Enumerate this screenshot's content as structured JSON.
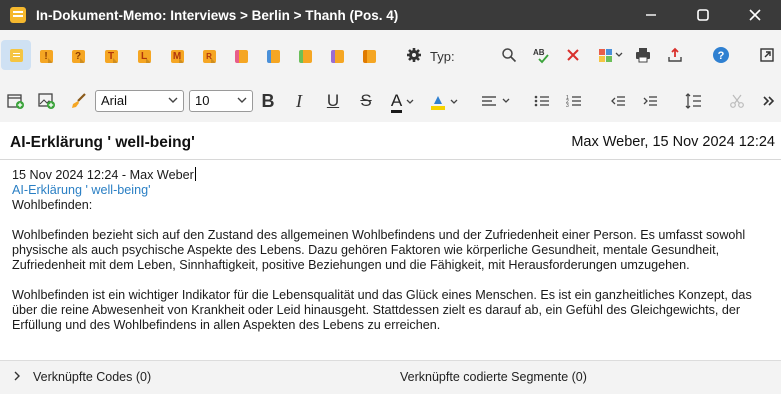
{
  "window": {
    "title": "In-Dokument-Memo: Interviews > Berlin > Thanh (Pos. 4)"
  },
  "toolbar1": {
    "memo_types": [
      {
        "name": "memo-default",
        "letter": "",
        "color": "#f5c542"
      },
      {
        "name": "memo-exclamation",
        "letter": "!",
        "color": "#f5a623"
      },
      {
        "name": "memo-question",
        "letter": "?",
        "color": "#f5a623"
      },
      {
        "name": "memo-t",
        "letter": "T",
        "color": "#f5a623"
      },
      {
        "name": "memo-l",
        "letter": "L",
        "color": "#f5a623"
      },
      {
        "name": "memo-m",
        "letter": "M",
        "color": "#f5a623"
      },
      {
        "name": "memo-r",
        "letter": "R",
        "color": "#f5a623"
      },
      {
        "name": "memo-pink",
        "letter": "",
        "color": "#e85d8a"
      },
      {
        "name": "memo-blue",
        "letter": "",
        "color": "#4a90d9"
      },
      {
        "name": "memo-green",
        "letter": "",
        "color": "#6bbf59"
      },
      {
        "name": "memo-purple",
        "letter": "",
        "color": "#9b6bd1"
      },
      {
        "name": "memo-orange",
        "letter": "",
        "color": "#f5a623"
      }
    ],
    "type_label": "Typ:"
  },
  "toolbar2": {
    "font_family": "Arial",
    "font_size": "10",
    "bold": "B",
    "italic": "I",
    "underline": "U",
    "strike": "S",
    "font_color": "A"
  },
  "memo": {
    "title": "AI-Erklärung ' well-being'",
    "meta": "Max Weber, 15 Nov 2024 12:24",
    "line1": "15 Nov 2024 12:24 - Max Weber",
    "line2": "AI-Erklärung ' well-being'",
    "line3": "Wohlbefinden:",
    "para1": "Wohlbefinden bezieht sich auf den Zustand des allgemeinen Wohlbefindens und der Zufriedenheit einer Person. Es umfasst sowohl physische als auch psychische Aspekte des Lebens. Dazu gehören Faktoren wie körperliche Gesundheit, mentale Gesundheit, Zufriedenheit mit dem Leben, Sinnhaftigkeit, positive Beziehungen und die Fähigkeit, mit Herausforderungen umzugehen.",
    "para2": "Wohlbefinden ist ein wichtiger Indikator für die Lebensqualität und das Glück eines Menschen. Es ist ein ganzheitliches Konzept, das über die reine Abwesenheit von Krankheit oder Leid hinausgeht. Stattdessen zielt es darauf ab, ein Gefühl des Gleichgewichts, der Erfüllung und des Wohlbefindens in allen Aspekten des Lebens zu erreichen."
  },
  "bottom": {
    "linked_codes": "Verknüpfte Codes (0)",
    "linked_segments": "Verknüpfte codierte Segmente (0)"
  },
  "colors": {
    "titlebar": "#3a3a3a",
    "toolbar": "#f3f3f3",
    "link": "#2a7fc4",
    "accent_blue": "#2f80d1",
    "red": "#d9302c"
  }
}
